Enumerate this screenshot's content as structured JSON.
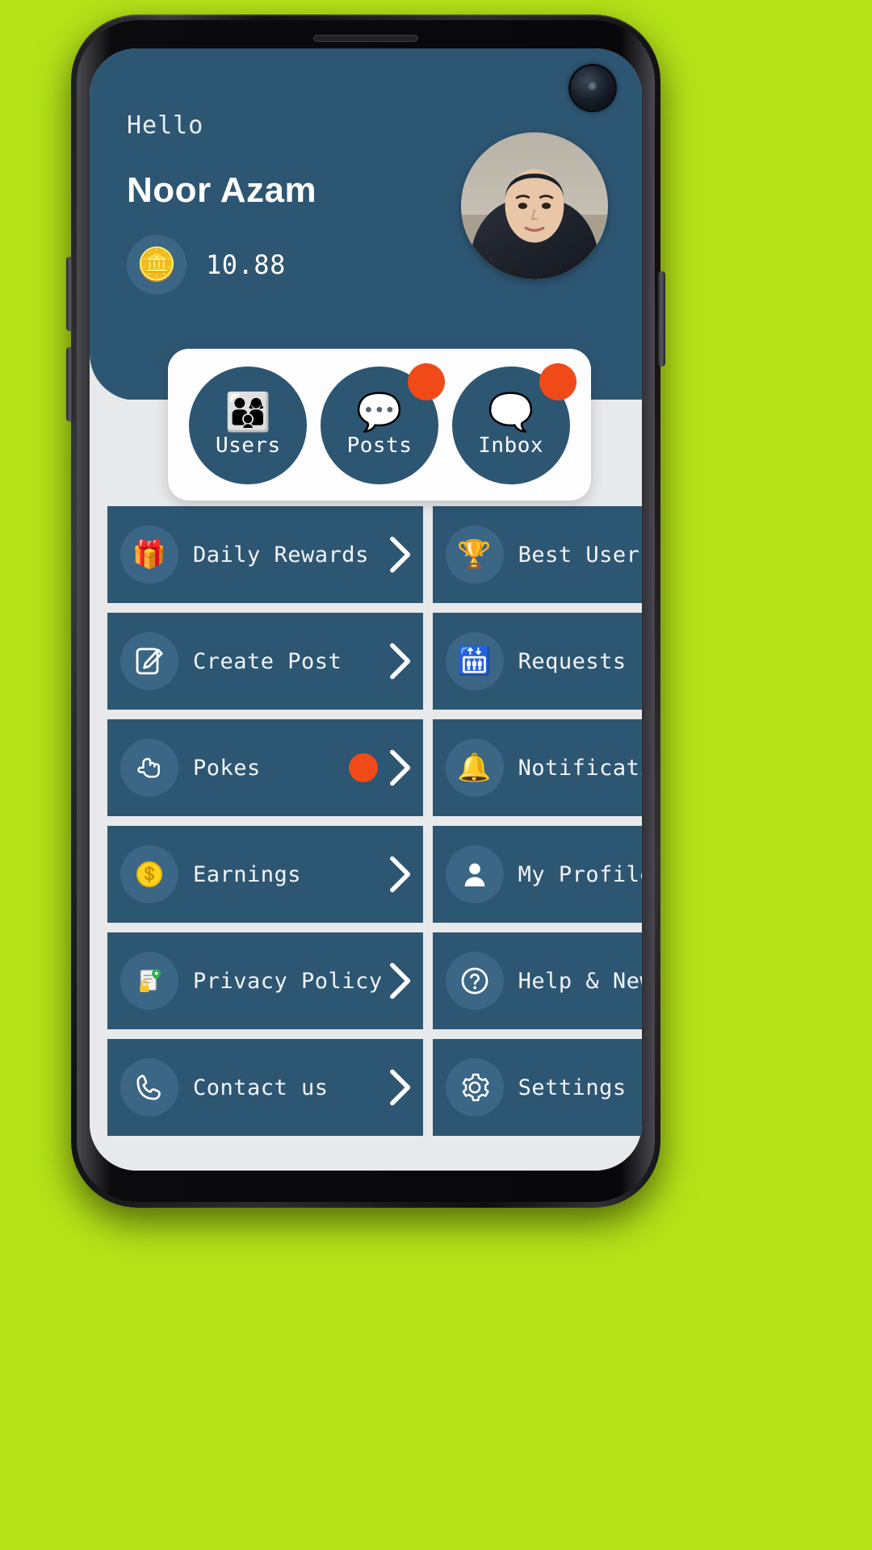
{
  "theme": {
    "page_background": "#b5e318",
    "primary": "#2d5673",
    "primary_light": "#3b6685",
    "surface": "#e8e9ea",
    "card": "#fdfdfd",
    "badge": "#f04a19",
    "text_on_primary": "#ffffff"
  },
  "header": {
    "greeting": "Hello",
    "user_name": "Noor Azam",
    "coin_icon": "coin-icon",
    "balance": "10.88",
    "avatar_name": "avatar"
  },
  "quick_actions": [
    {
      "label": "Users",
      "icon": "users-group-icon",
      "badge": false
    },
    {
      "label": "Posts",
      "icon": "heart-speech-bubble-icon",
      "badge": true
    },
    {
      "label": "Inbox",
      "icon": "chat-bubbles-icon",
      "badge": true
    }
  ],
  "menu": [
    {
      "label": "Daily Rewards",
      "icon": "gift-icon",
      "badge": false,
      "chevron": "chevron-right-icon"
    },
    {
      "label": "Best Users",
      "icon": "trophy-podium-icon",
      "badge": false,
      "chevron": "chevron-right-icon"
    },
    {
      "label": "Create Post",
      "icon": "compose-icon",
      "badge": false,
      "chevron": "chevron-right-icon"
    },
    {
      "label": "Requests",
      "icon": "person-request-icon",
      "badge": false,
      "chevron": "chevron-right-icon"
    },
    {
      "label": "Pokes",
      "icon": "pointing-hand-icon",
      "badge": true,
      "chevron": "chevron-right-icon"
    },
    {
      "label": "Notification",
      "icon": "bell-icon",
      "badge": true,
      "chevron": "chevron-right-icon"
    },
    {
      "label": "Earnings",
      "icon": "dollar-coin-icon",
      "badge": false,
      "chevron": "chevron-right-icon"
    },
    {
      "label": "My Profile",
      "icon": "person-icon",
      "badge": false,
      "chevron": "chevron-right-icon"
    },
    {
      "label": "Privacy Policy",
      "icon": "privacy-lock-icon",
      "badge": false,
      "chevron": "chevron-right-icon"
    },
    {
      "label": "Help & News",
      "icon": "question-mark-icon",
      "badge": false,
      "chevron": "chevron-right-icon"
    },
    {
      "label": "Contact us",
      "icon": "phone-icon",
      "badge": false,
      "chevron": "chevron-right-icon"
    },
    {
      "label": "Settings",
      "icon": "gear-icon",
      "badge": false,
      "chevron": "chevron-right-icon"
    }
  ],
  "device": {
    "earpiece": "earpiece-speaker",
    "camera": "front-camera-punch-hole"
  }
}
